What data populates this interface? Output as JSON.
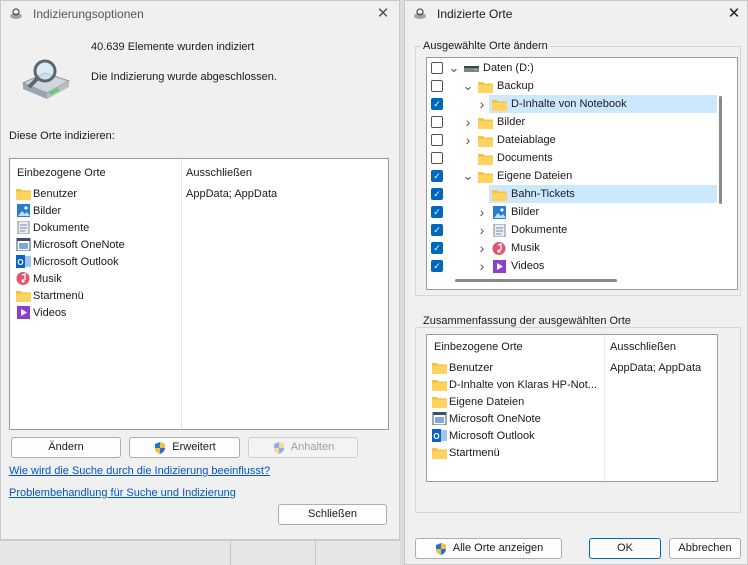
{
  "left_window": {
    "title": "Indizierungsoptionen",
    "count_text": "40.639 Elemente wurden indiziert",
    "status_text": "Die Indizierung wurde abgeschlossen.",
    "section_label": "Diese Orte indizieren:",
    "col_included": "Einbezogene Orte",
    "col_excluded": "Ausschließen",
    "excluded_value": "AppData; AppData",
    "locations": [
      {
        "label": "Benutzer",
        "icon": "folder-icon"
      },
      {
        "label": "Bilder",
        "icon": "pictures-icon"
      },
      {
        "label": "Dokumente",
        "icon": "documents-icon"
      },
      {
        "label": "Microsoft OneNote",
        "icon": "onenote-icon"
      },
      {
        "label": "Microsoft Outlook",
        "icon": "outlook-icon"
      },
      {
        "label": "Musik",
        "icon": "music-icon"
      },
      {
        "label": "Startmenü",
        "icon": "folder-icon"
      },
      {
        "label": "Videos",
        "icon": "videos-icon"
      }
    ],
    "btn_change": "Ändern",
    "btn_advanced": "Erweitert",
    "btn_pause": "Anhalten",
    "link_search": "Wie wird die Suche durch die Indizierung beeinflusst?",
    "link_troubleshoot": "Problembehandlung für Suche und Indizierung",
    "btn_close": "Schließen"
  },
  "right_window": {
    "title": "Indizierte Orte",
    "group_change": "Ausgewählte Orte ändern",
    "tree": [
      {
        "label": "Daten (D:)",
        "checked": false,
        "arrow": "v",
        "indent": 0,
        "icon": "drive-icon",
        "selected": false
      },
      {
        "label": "Backup",
        "checked": false,
        "arrow": "v",
        "indent": 1,
        "icon": "folder-icon",
        "selected": false
      },
      {
        "label": "D-Inhalte von Notebook",
        "checked": true,
        "arrow": ">",
        "indent": 2,
        "icon": "folder-icon",
        "selected": true
      },
      {
        "label": "Bilder",
        "checked": false,
        "arrow": ">",
        "indent": 1,
        "icon": "folder-icon",
        "selected": false
      },
      {
        "label": "Dateiablage",
        "checked": false,
        "arrow": ">",
        "indent": 1,
        "icon": "folder-icon",
        "selected": false
      },
      {
        "label": "Documents",
        "checked": false,
        "arrow": "",
        "indent": 1,
        "icon": "folder-icon",
        "selected": false
      },
      {
        "label": "Eigene Dateien",
        "checked": true,
        "arrow": "v",
        "indent": 1,
        "icon": "folder-icon",
        "selected": false
      },
      {
        "label": "Bahn-Tickets",
        "checked": true,
        "arrow": "",
        "indent": 2,
        "icon": "folder-icon",
        "selected": true
      },
      {
        "label": "Bilder",
        "checked": true,
        "arrow": ">",
        "indent": 2,
        "icon": "pictures-icon",
        "selected": false
      },
      {
        "label": "Dokumente",
        "checked": true,
        "arrow": ">",
        "indent": 2,
        "icon": "documents-icon",
        "selected": false
      },
      {
        "label": "Musik",
        "checked": true,
        "arrow": ">",
        "indent": 2,
        "icon": "music-icon",
        "selected": false
      },
      {
        "label": "Videos",
        "checked": true,
        "arrow": ">",
        "indent": 2,
        "icon": "videos-icon",
        "selected": false
      }
    ],
    "group_summary": "Zusammenfassung der ausgewählten Orte",
    "col_included": "Einbezogene Orte",
    "col_excluded": "Ausschließen",
    "excluded_value": "AppData; AppData",
    "summary_items": [
      {
        "label": "Benutzer",
        "icon": "folder-icon"
      },
      {
        "label": "D-Inhalte von Klaras HP-Not...",
        "icon": "folder-icon"
      },
      {
        "label": "Eigene Dateien",
        "icon": "folder-icon"
      },
      {
        "label": "Microsoft OneNote",
        "icon": "onenote-icon"
      },
      {
        "label": "Microsoft Outlook",
        "icon": "outlook-icon"
      },
      {
        "label": "Startmenü",
        "icon": "folder-icon"
      }
    ],
    "btn_show_all": "Alle Orte anzeigen",
    "btn_ok": "OK",
    "btn_cancel": "Abbrechen"
  },
  "colors": {
    "accent": "#0067c0",
    "selection": "#cce8ff",
    "link": "#0055cc"
  }
}
